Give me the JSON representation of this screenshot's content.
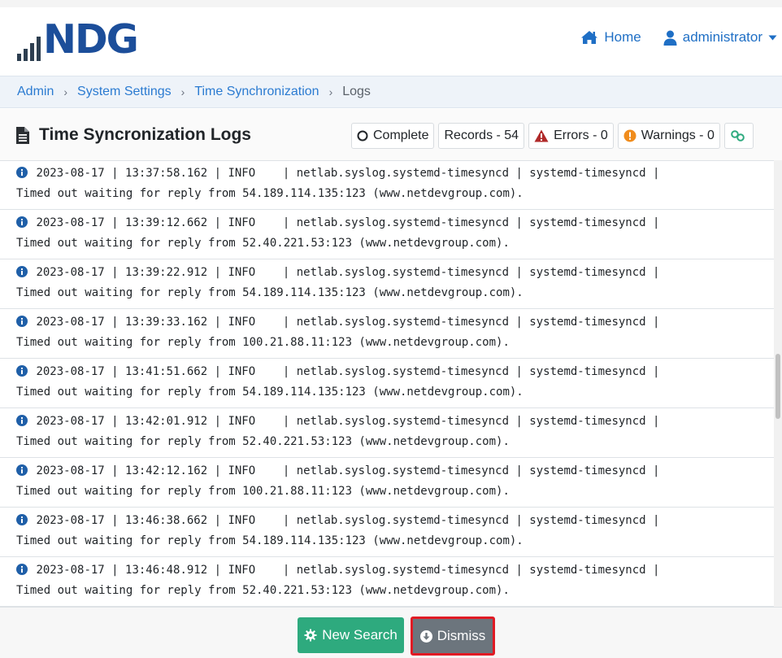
{
  "brand": {
    "logo_text": "NDG"
  },
  "nav": {
    "home_label": "Home",
    "user_label": "administrator",
    "accent_color": "#1f6fc5"
  },
  "breadcrumb": {
    "items": [
      "Admin",
      "System Settings",
      "Time Synchronization"
    ],
    "current": "Logs",
    "separator": "›"
  },
  "page": {
    "title": "Time Syncronization Logs"
  },
  "status": {
    "complete_label": "Complete",
    "records_label": "Records - 54",
    "errors_label": "Errors - 0",
    "warnings_label": "Warnings - 0"
  },
  "logs": [
    {
      "line1": "2023-08-17 | 13:37:58.162 | INFO    | netlab.syslog.systemd-timesyncd | systemd-timesyncd |",
      "line2": "Timed out waiting for reply from 54.189.114.135:123 (www.netdevgroup.com)."
    },
    {
      "line1": "2023-08-17 | 13:39:12.662 | INFO    | netlab.syslog.systemd-timesyncd | systemd-timesyncd |",
      "line2": "Timed out waiting for reply from 52.40.221.53:123 (www.netdevgroup.com)."
    },
    {
      "line1": "2023-08-17 | 13:39:22.912 | INFO    | netlab.syslog.systemd-timesyncd | systemd-timesyncd |",
      "line2": "Timed out waiting for reply from 54.189.114.135:123 (www.netdevgroup.com)."
    },
    {
      "line1": "2023-08-17 | 13:39:33.162 | INFO    | netlab.syslog.systemd-timesyncd | systemd-timesyncd |",
      "line2": "Timed out waiting for reply from 100.21.88.11:123 (www.netdevgroup.com)."
    },
    {
      "line1": "2023-08-17 | 13:41:51.662 | INFO    | netlab.syslog.systemd-timesyncd | systemd-timesyncd |",
      "line2": "Timed out waiting for reply from 54.189.114.135:123 (www.netdevgroup.com)."
    },
    {
      "line1": "2023-08-17 | 13:42:01.912 | INFO    | netlab.syslog.systemd-timesyncd | systemd-timesyncd |",
      "line2": "Timed out waiting for reply from 52.40.221.53:123 (www.netdevgroup.com)."
    },
    {
      "line1": "2023-08-17 | 13:42:12.162 | INFO    | netlab.syslog.systemd-timesyncd | systemd-timesyncd |",
      "line2": "Timed out waiting for reply from 100.21.88.11:123 (www.netdevgroup.com)."
    },
    {
      "line1": "2023-08-17 | 13:46:38.662 | INFO    | netlab.syslog.systemd-timesyncd | systemd-timesyncd |",
      "line2": "Timed out waiting for reply from 54.189.114.135:123 (www.netdevgroup.com)."
    },
    {
      "line1": "2023-08-17 | 13:46:48.912 | INFO    | netlab.syslog.systemd-timesyncd | systemd-timesyncd |",
      "line2": "Timed out waiting for reply from 52.40.221.53:123 (www.netdevgroup.com)."
    }
  ],
  "actions": {
    "new_search_label": "New Search",
    "dismiss_label": "Dismiss"
  },
  "colors": {
    "success": "#2eaa7e",
    "secondary": "#6c757d",
    "error": "#b02a2a",
    "warning": "#f08c1c",
    "highlight": "#e01b24"
  }
}
